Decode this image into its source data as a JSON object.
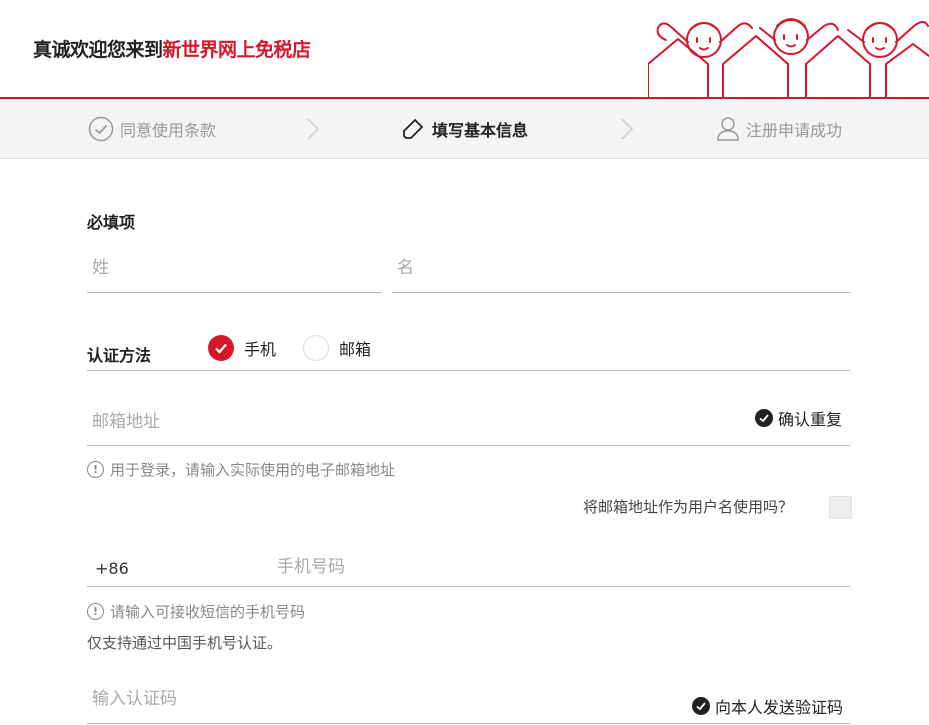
{
  "header": {
    "welcome_prefix": "真诚欢迎您来到",
    "welcome_brand": "新世界网上免税店",
    "colors": {
      "brand_red": "#d6172a"
    }
  },
  "steps": [
    {
      "label": "同意使用条款",
      "icon": "check-circle-icon",
      "state": "done"
    },
    {
      "label": "填写基本信息",
      "icon": "pencil-icon",
      "state": "active"
    },
    {
      "label": "注册申请成功",
      "icon": "user-icon",
      "state": "pending"
    }
  ],
  "form": {
    "required_title": "必填项",
    "last_name_placeholder": "姓",
    "first_name_placeholder": "名",
    "auth_method_label": "认证方法",
    "auth_options": [
      {
        "label": "手机",
        "selected": true
      },
      {
        "label": "邮箱",
        "selected": false
      }
    ],
    "email_placeholder": "邮箱地址",
    "email_confirm_label": "确认重复",
    "email_hint": "用于登录，请输入实际使用的电子邮箱地址",
    "email_as_username_question": "将邮箱地址作为用户名使用吗？",
    "country_code": "+86",
    "phone_placeholder": "手机号码",
    "phone_hint": "请输入可接收短信的手机号码",
    "phone_note": "仅支持通过中国手机号认证。",
    "code_placeholder": "输入认证码",
    "send_code_label": "向本人发送验证码"
  }
}
